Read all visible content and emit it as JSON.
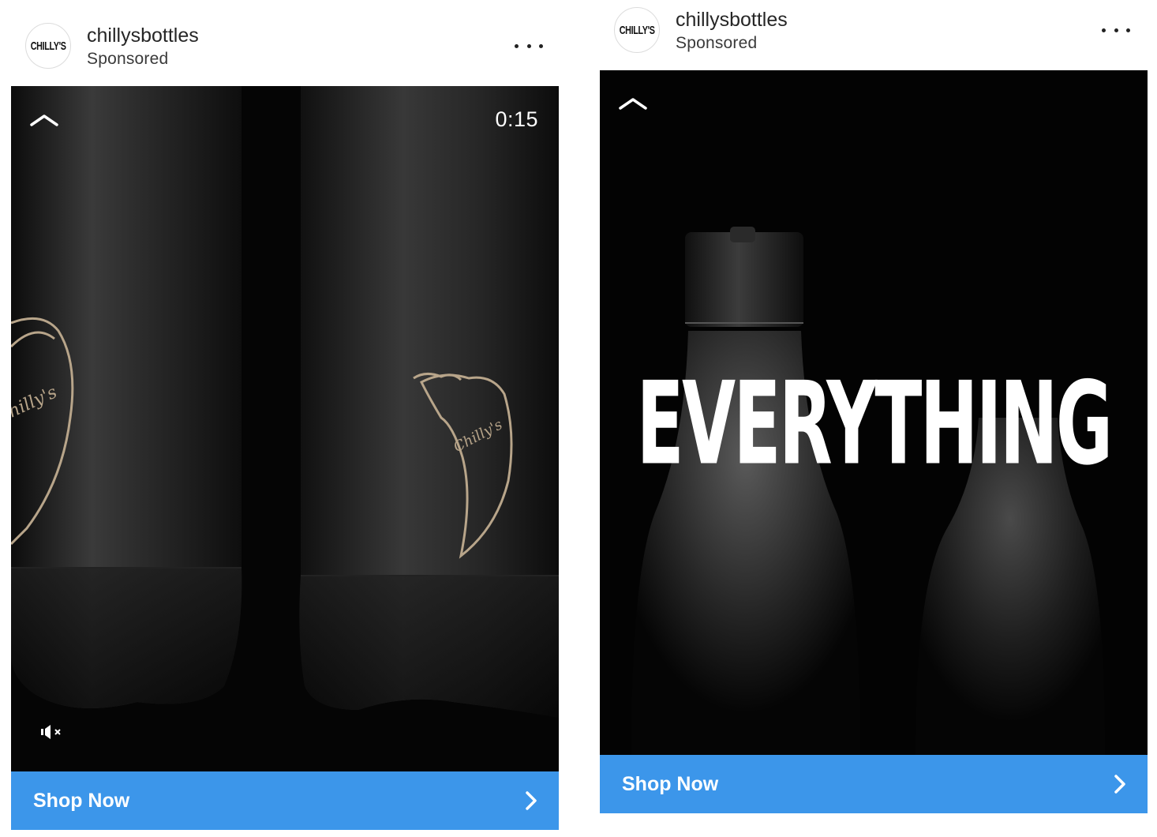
{
  "posts": [
    {
      "avatar_text": "CHILLY'S",
      "username": "chillysbottles",
      "sponsored_label": "Sponsored",
      "more_icon": "more-horizontal-icon",
      "video_timer": "0:15",
      "cta_label": "Shop Now"
    },
    {
      "avatar_text": "CHILLY'S",
      "username": "chillysbottles",
      "sponsored_label": "Sponsored",
      "more_icon": "more-horizontal-icon",
      "overlay_text": "EVERYTHING",
      "cta_label": "Shop Now"
    }
  ],
  "colors": {
    "cta_blue": "#3c96ea",
    "media_background": "#000000",
    "pepper_outline": "#b8a58a"
  }
}
